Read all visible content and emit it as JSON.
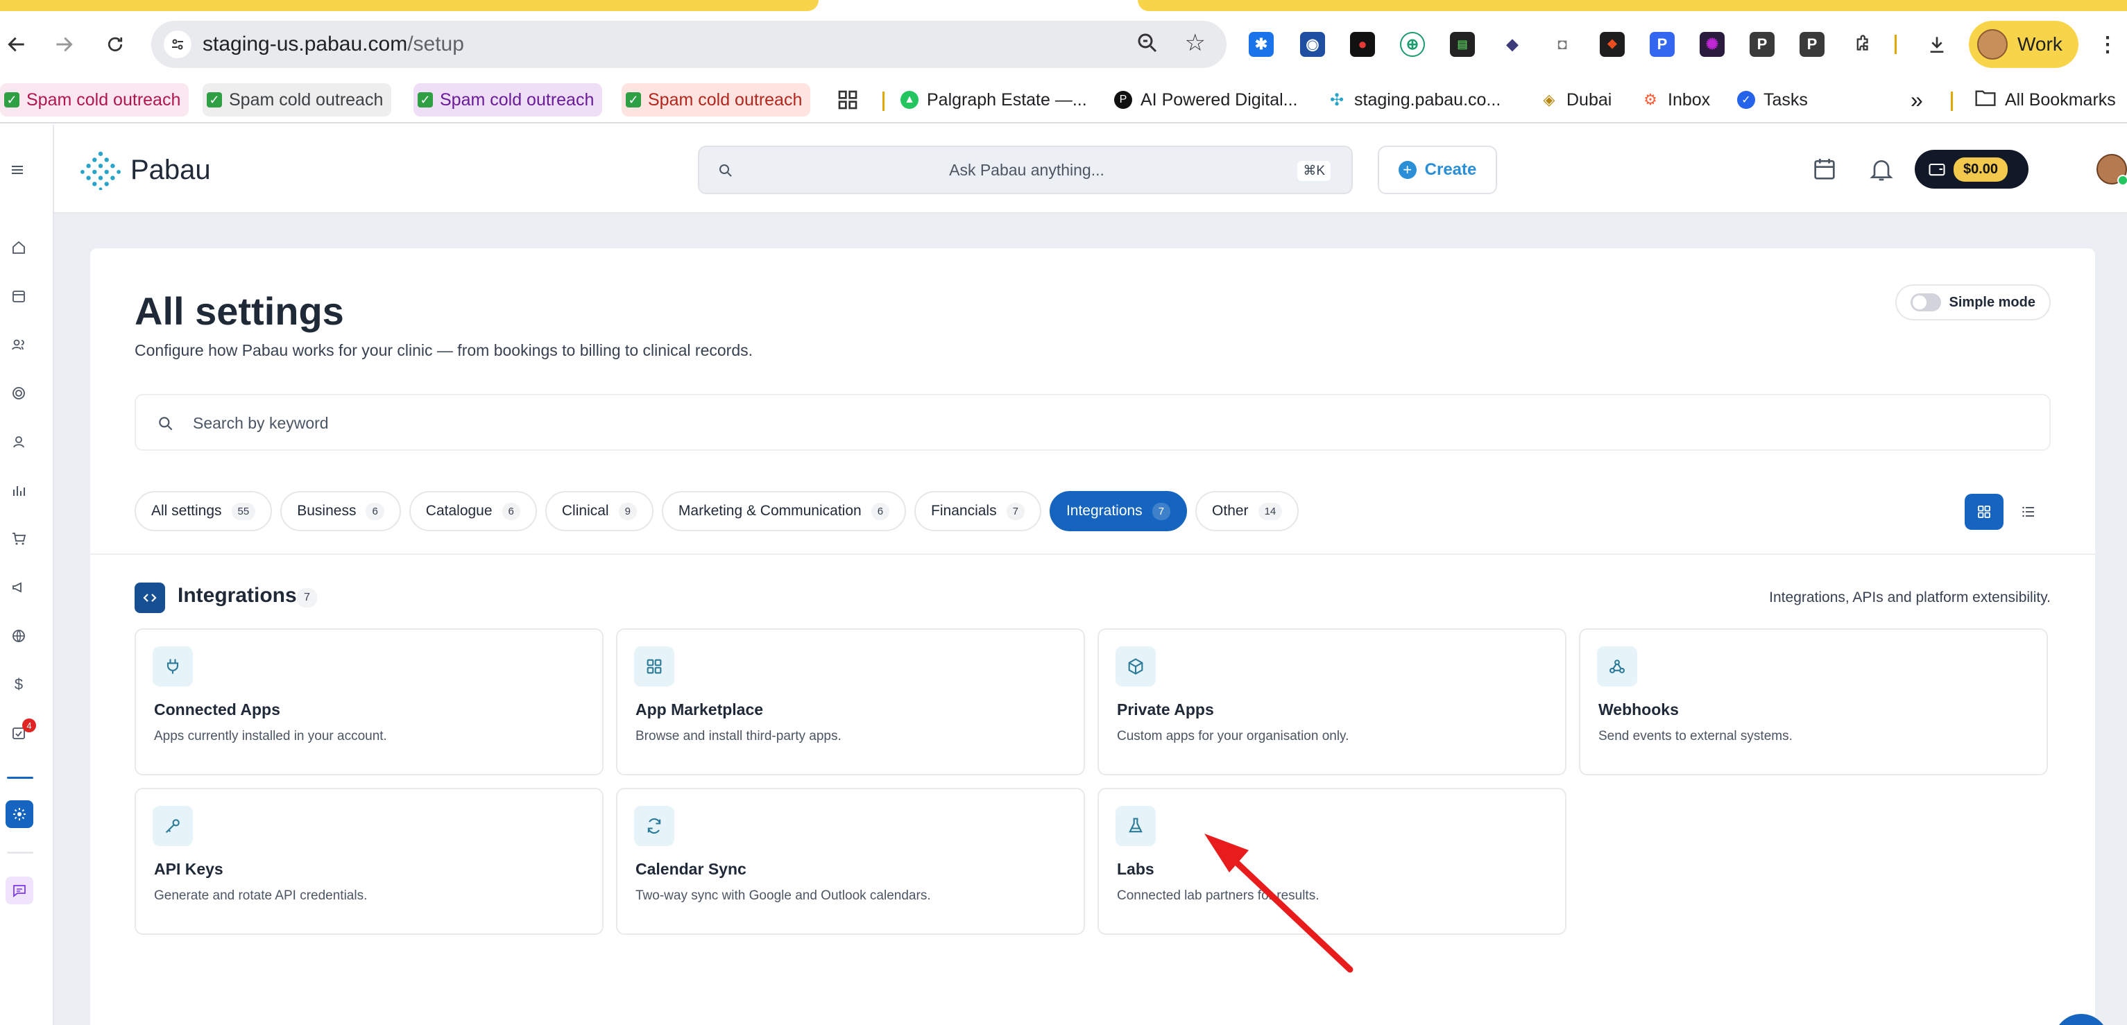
{
  "browser": {
    "url_host": "staging-us.pabau.com",
    "url_path": "/setup",
    "profile_label": "Work",
    "extensions": [
      "asterisk-ext",
      "shield-ext",
      "record-ext",
      "green-globe-ext",
      "terminal-ext",
      "cube-ext",
      "camera-ext",
      "figma-ext",
      "p-blue-ext",
      "purple-app-ext",
      "p-dark-ext",
      "p-dark2-ext",
      "puzzle-ext"
    ],
    "bookmarks": [
      {
        "label": "Spam cold outreach",
        "bg": "#fbe7ef",
        "fg": "#b0174d"
      },
      {
        "label": "Spam cold outreach",
        "bg": "#eeeeee",
        "fg": "#3c4043"
      },
      {
        "label": "Spam cold outreach",
        "bg": "#eedff7",
        "fg": "#6a1b9a"
      },
      {
        "label": "Spam cold outreach",
        "bg": "#fde4e1",
        "fg": "#b3261e"
      },
      {
        "label": "Palgraph Estate —...",
        "icon": "palgraph-icon"
      },
      {
        "label": "AI Powered Digital...",
        "icon": "ai-digital-icon"
      },
      {
        "label": "staging.pabau.co...",
        "icon": "pabau-icon"
      },
      {
        "label": "Dubai",
        "icon": "dubai-icon"
      },
      {
        "label": "Inbox",
        "icon": "hubspot-icon"
      },
      {
        "label": "Tasks",
        "icon": "tasks-icon"
      }
    ],
    "more_glyph": "»",
    "all_bookmarks": "All Bookmarks"
  },
  "header": {
    "logo": "Pabau",
    "ask_placeholder": "Ask Pabau anything...",
    "ask_shortcut": "⌘K",
    "create_label": "Create",
    "wallet_amount": "$0.00"
  },
  "rail": {
    "badge_count": "4"
  },
  "page": {
    "title": "All settings",
    "subtitle": "Configure how Pabau works for your clinic — from bookings to billing to clinical records.",
    "simple_mode_label": "Simple mode",
    "simple_mode_on": false,
    "search_placeholder": "Search by keyword",
    "tabs": [
      {
        "label": "All settings",
        "count": "55",
        "active": false
      },
      {
        "label": "Business",
        "count": "6",
        "active": false
      },
      {
        "label": "Catalogue",
        "count": "6",
        "active": false
      },
      {
        "label": "Clinical",
        "count": "9",
        "active": false
      },
      {
        "label": "Marketing & Communication",
        "count": "6",
        "active": false
      },
      {
        "label": "Financials",
        "count": "7",
        "active": false
      },
      {
        "label": "Integrations",
        "count": "7",
        "active": true
      },
      {
        "label": "Other",
        "count": "14",
        "active": false
      }
    ],
    "view": "grid"
  },
  "section": {
    "title": "Integrations",
    "count": "7",
    "description": "Integrations, APIs and platform extensibility.",
    "cards": [
      {
        "title": "Connected Apps",
        "desc": "Apps currently installed in your account.",
        "icon": "plug-icon"
      },
      {
        "title": "App Marketplace",
        "desc": "Browse and install third-party apps.",
        "icon": "grid-icon"
      },
      {
        "title": "Private Apps",
        "desc": "Custom apps for your organisation only.",
        "icon": "box-icon"
      },
      {
        "title": "Webhooks",
        "desc": "Send events to external systems.",
        "icon": "webhook-icon"
      },
      {
        "title": "API Keys",
        "desc": "Generate and rotate API credentials.",
        "icon": "key-icon"
      },
      {
        "title": "Calendar Sync",
        "desc": "Two-way sync with Google and Outlook calendars.",
        "icon": "sync-icon"
      },
      {
        "title": "Labs",
        "desc": "Connected lab partners for results.",
        "icon": "flask-icon"
      }
    ]
  },
  "colors": {
    "primary": "#1565c0",
    "annotation_arrow": "#e81c1c",
    "wallet_bg": "#111827",
    "wallet_amount_bg": "#f2c94c"
  }
}
